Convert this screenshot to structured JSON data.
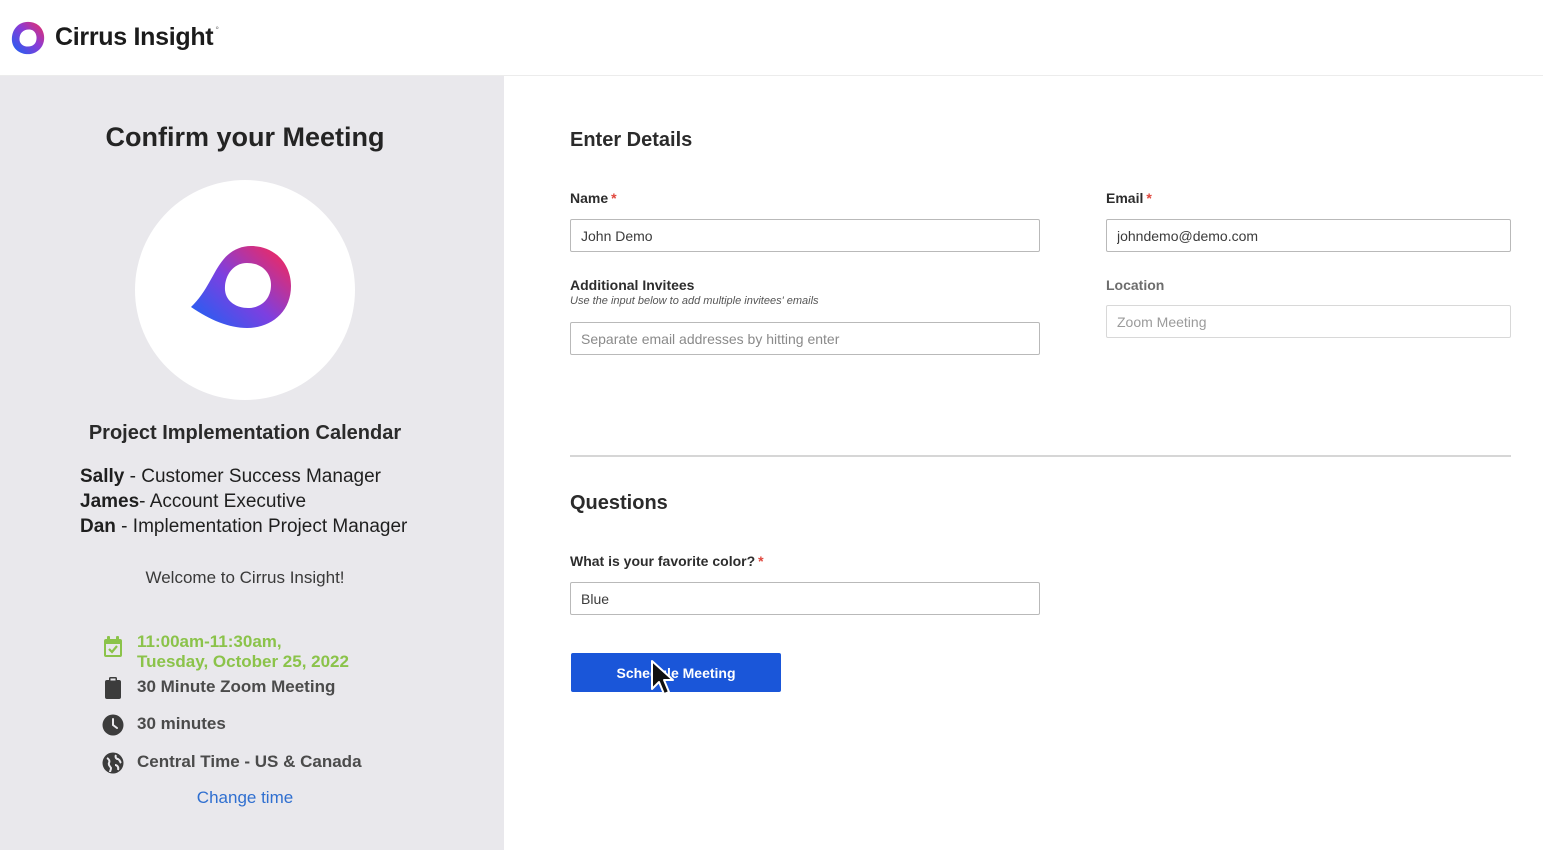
{
  "header": {
    "brand_name": "Cirrus Insight",
    "brand_mark": "°",
    "logo_icon": "cirrus-insight-logo"
  },
  "sidebar": {
    "title": "Confirm your Meeting",
    "calendar_name": "Project Implementation Calendar",
    "team": [
      {
        "name": "Sally",
        "sep": " - ",
        "role": "Customer Success Manager"
      },
      {
        "name": "James",
        "sep": "- ",
        "role": "Account Executive"
      },
      {
        "name": "Dan",
        "sep": " - ",
        "role": "Implementation Project Manager"
      }
    ],
    "welcome": "Welcome to Cirrus Insight!",
    "datetime_line1": "11:00am-11:30am,",
    "datetime_line2": "Tuesday, October 25, 2022",
    "meeting_type": "30 Minute Zoom Meeting",
    "duration": "30 minutes",
    "timezone": "Central Time - US & Canada",
    "change_time": "Change time",
    "icons": [
      "calendar-icon",
      "clipboard-icon",
      "clock-icon",
      "globe-icon"
    ],
    "accent_green": "#8bc34a",
    "link_color": "#2f6fd0"
  },
  "form": {
    "details_title": "Enter Details",
    "name_label": "Name",
    "name_value": "John Demo",
    "email_label": "Email",
    "email_value": "johndemo@demo.com",
    "invitees_label": "Additional Invitees",
    "invitees_hint": "Use the input below to add multiple invitees' emails",
    "invitees_placeholder": "Separate email addresses by hitting enter",
    "location_label": "Location",
    "location_value": "Zoom Meeting",
    "required_mark": "*",
    "questions_title": "Questions",
    "color_question": "What is your favorite color?",
    "color_value": "Blue",
    "submit_label": "Schedule Meeting",
    "button_color": "#1a56d9"
  }
}
